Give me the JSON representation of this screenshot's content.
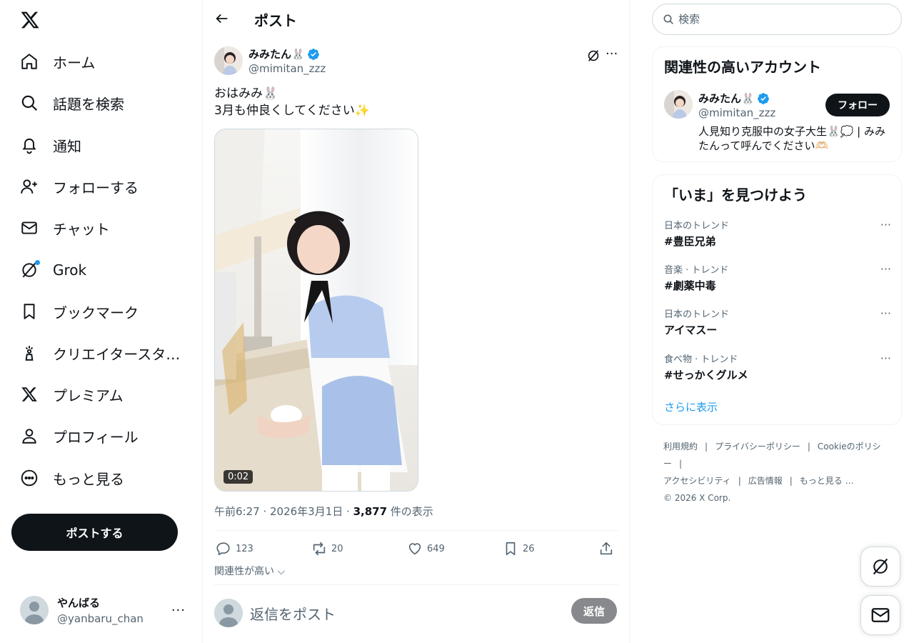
{
  "nav": {
    "items": [
      {
        "label": "ホーム",
        "icon": "home-icon"
      },
      {
        "label": "話題を検索",
        "icon": "search-icon"
      },
      {
        "label": "通知",
        "icon": "bell-icon"
      },
      {
        "label": "フォローする",
        "icon": "add-person-icon"
      },
      {
        "label": "チャット",
        "icon": "mail-icon"
      },
      {
        "label": "Grok",
        "icon": "grok-icon"
      },
      {
        "label": "ブックマーク",
        "icon": "bookmark-icon"
      },
      {
        "label": "クリエイタースタ…",
        "icon": "creator-icon"
      },
      {
        "label": "プレミアム",
        "icon": "x-icon"
      },
      {
        "label": "プロフィール",
        "icon": "profile-icon"
      },
      {
        "label": "もっと見る",
        "icon": "more-circle-icon"
      }
    ],
    "post_button": "ポストする",
    "account": {
      "name": "やんばる",
      "handle": "@yanbaru_chan",
      "more": "···"
    }
  },
  "header": {
    "title": "ポスト"
  },
  "post": {
    "author_name": "みみたん🐰",
    "author_handle": "@mimitan_zzz",
    "text_line1": "おはみみ🐰",
    "text_line2": "3月も仲良くしてください✨",
    "video_duration": "0:02",
    "time": "午前6:27 · 2026年3月1日 · ",
    "views": "3,877",
    "views_label": " 件の表示",
    "more": "···",
    "actions": {
      "replies": "123",
      "reposts": "20",
      "likes": "649",
      "bookmarks": "26"
    },
    "sort_label": "関連性が高い",
    "reply_placeholder": "返信をポスト",
    "reply_button": "返信"
  },
  "search": {
    "placeholder": "検索"
  },
  "relevant": {
    "title": "関連性の高いアカウント",
    "name": "みみたん🐰",
    "handle": "@mimitan_zzz",
    "bio": "人見知り克服中の女子大生🐰💭 | みみたんって呼んでください🫶🏻",
    "follow": "フォロー"
  },
  "trends": {
    "title": "「いま」を見つけよう",
    "items": [
      {
        "category": "日本のトレンド",
        "title": "#豊臣兄弟"
      },
      {
        "category": "音楽 · トレンド",
        "title": "#劇薬中毒"
      },
      {
        "category": "日本のトレンド",
        "title": "アイマスー"
      },
      {
        "category": "食べ物 · トレンド",
        "title": "#せっかくグルメ"
      }
    ],
    "more": "···",
    "show_more": "さらに表示"
  },
  "footer": {
    "links": [
      "利用規約",
      "プライバシーポリシー",
      "Cookieのポリシー",
      "アクセシビリティ",
      "広告情報",
      "もっと見る …"
    ],
    "copyright": "© 2026 X Corp."
  },
  "colors": {
    "accent": "#1d9bf0",
    "text": "#0f1419",
    "muted": "#536471",
    "border": "#eff3f4"
  }
}
